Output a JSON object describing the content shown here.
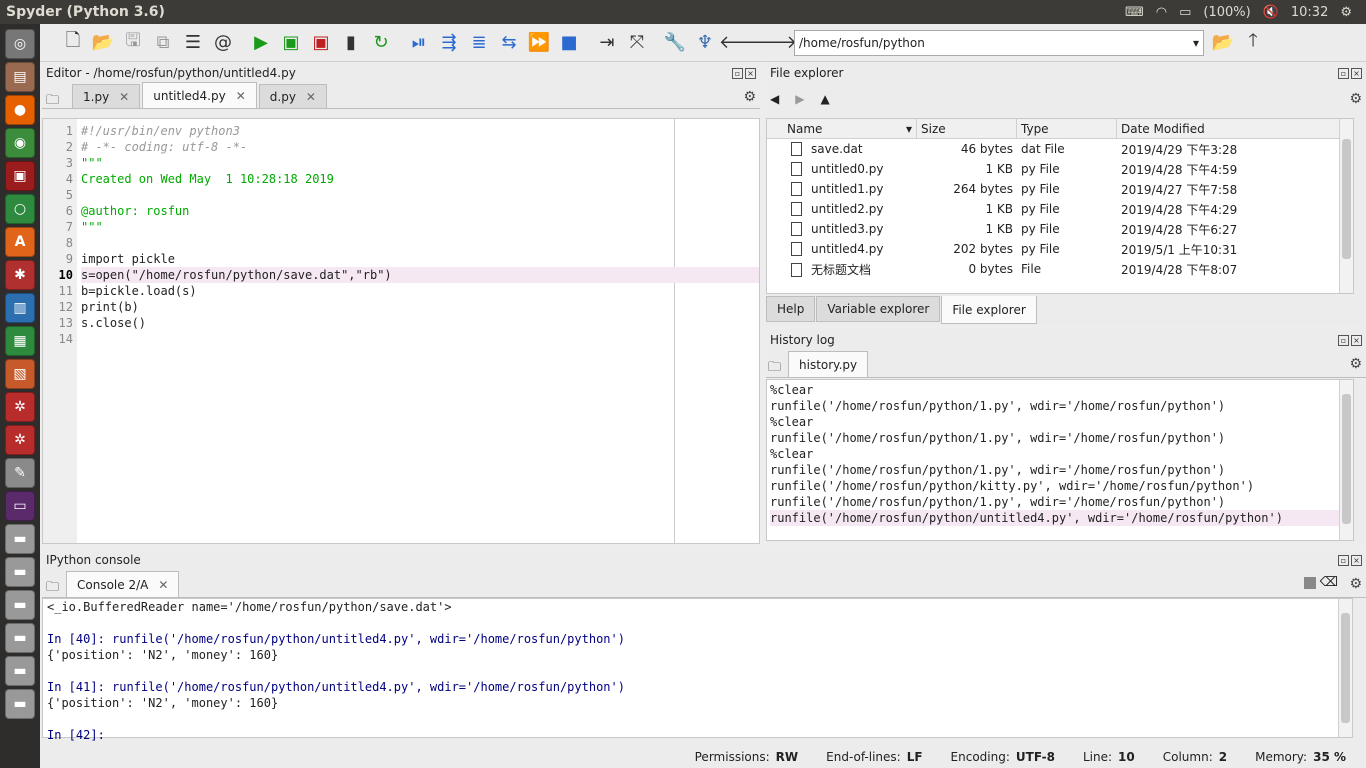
{
  "window": {
    "title": "Spyder (Python 3.6)"
  },
  "tray": {
    "battery": "(100%)",
    "time": "10:32"
  },
  "toolbar": {
    "path": "/home/rosfun/python"
  },
  "editor": {
    "title": "Editor - /home/rosfun/python/untitled4.py",
    "tabs": [
      "1.py",
      "untitled4.py",
      "d.py"
    ],
    "line_numbers": [
      "1",
      "2",
      "3",
      "4",
      "5",
      "6",
      "7",
      "8",
      "9",
      "10",
      "11",
      "12",
      "13",
      "14"
    ],
    "lines": [
      "#!/usr/bin/env python3",
      "# -*- coding: utf-8 -*-",
      "\"\"\"",
      "Created on Wed May  1 10:28:18 2019",
      "",
      "@author: rosfun",
      "\"\"\"",
      "",
      "import pickle",
      "s=open(\"/home/rosfun/python/save.dat\",\"rb\")",
      "b=pickle.load(s)",
      "print(b)",
      "s.close()",
      ""
    ]
  },
  "file_explorer": {
    "title": "File explorer",
    "columns": [
      "Name",
      "Size",
      "Type",
      "Date Modified"
    ],
    "rows": [
      {
        "name": "save.dat",
        "size": "46 bytes",
        "type": "dat File",
        "date": "2019/4/29 下午3:28"
      },
      {
        "name": "untitled0.py",
        "size": "1 KB",
        "type": "py File",
        "date": "2019/4/28 下午4:59"
      },
      {
        "name": "untitled1.py",
        "size": "264 bytes",
        "type": "py File",
        "date": "2019/4/27 下午7:58"
      },
      {
        "name": "untitled2.py",
        "size": "1 KB",
        "type": "py File",
        "date": "2019/4/28 下午4:29"
      },
      {
        "name": "untitled3.py",
        "size": "1 KB",
        "type": "py File",
        "date": "2019/4/28 下午6:27"
      },
      {
        "name": "untitled4.py",
        "size": "202 bytes",
        "type": "py File",
        "date": "2019/5/1 上午10:31"
      },
      {
        "name": "无标题文档",
        "size": "0 bytes",
        "type": "File",
        "date": "2019/4/28 下午8:07"
      }
    ],
    "bottom_tabs": [
      "Help",
      "Variable explorer",
      "File explorer"
    ]
  },
  "history": {
    "title": "History log",
    "tab": "history.py",
    "lines": [
      "%clear",
      "runfile('/home/rosfun/python/1.py', wdir='/home/rosfun/python')",
      "%clear",
      "runfile('/home/rosfun/python/1.py', wdir='/home/rosfun/python')",
      "%clear",
      "runfile('/home/rosfun/python/1.py', wdir='/home/rosfun/python')",
      "runfile('/home/rosfun/python/kitty.py', wdir='/home/rosfun/python')",
      "runfile('/home/rosfun/python/1.py', wdir='/home/rosfun/python')",
      "runfile('/home/rosfun/python/untitled4.py', wdir='/home/rosfun/python')"
    ]
  },
  "console": {
    "title": "IPython console",
    "tab": "Console 2/A",
    "lines": [
      "<_io.BufferedReader name='/home/rosfun/python/save.dat'>",
      "",
      "In [40]: runfile('/home/rosfun/python/untitled4.py', wdir='/home/rosfun/python')",
      "{'position': 'N2', 'money': 160}",
      "",
      "In [41]: runfile('/home/rosfun/python/untitled4.py', wdir='/home/rosfun/python')",
      "{'position': 'N2', 'money': 160}",
      "",
      "In [42]: "
    ]
  },
  "status": {
    "permissions_label": "Permissions:",
    "permissions": "RW",
    "eol_label": "End-of-lines:",
    "eol": "LF",
    "encoding_label": "Encoding:",
    "encoding": "UTF-8",
    "line_label": "Line:",
    "line": "10",
    "column_label": "Column:",
    "column": "2",
    "memory_label": "Memory:",
    "memory": "35 %"
  }
}
